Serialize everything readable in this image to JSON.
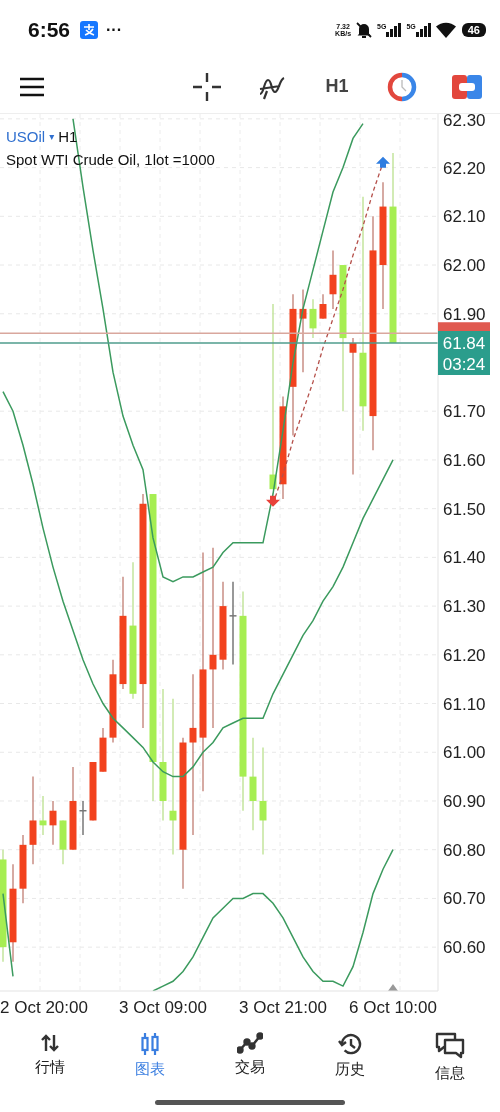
{
  "status_bar": {
    "time": "6:56",
    "more": "···",
    "speed_value": "7.32",
    "speed_unit": "KB/s",
    "network_1": "5G",
    "network_2": "5G",
    "battery": "46"
  },
  "toolbar": {
    "timeframe": "H1"
  },
  "chart": {
    "symbol": "USOil",
    "symbol_caret": "▾",
    "timeframe": "H1",
    "description": "Spot WTI Crude Oil, 1lot =1000",
    "countdown": "03:24",
    "chart_data": {
      "type": "candlestick",
      "grid": true,
      "ylim": [
        60.51,
        62.31
      ],
      "categories": [
        null,
        null,
        null,
        null,
        "2 Oct 20:00",
        null,
        null,
        null,
        null,
        null,
        null,
        null,
        null,
        null,
        null,
        null,
        "3 Oct 09:00",
        null,
        null,
        null,
        null,
        null,
        null,
        null,
        null,
        null,
        null,
        null,
        "3 Oct 21:00",
        null,
        null,
        null,
        null,
        null,
        null,
        null,
        null,
        null,
        null,
        "6 Oct 10:00"
      ],
      "yticks": [
        {
          "value": 62.3,
          "label": "62.30"
        },
        {
          "value": 62.2,
          "label": "62.20"
        },
        {
          "value": 62.1,
          "label": "62.10"
        },
        {
          "value": 62.0,
          "label": "62.00"
        },
        {
          "value": 61.9,
          "label": "61.90"
        },
        {
          "value": 61.7,
          "label": "61.70"
        },
        {
          "value": 61.6,
          "label": "61.60"
        },
        {
          "value": 61.5,
          "label": "61.50"
        },
        {
          "value": 61.4,
          "label": "61.40"
        },
        {
          "value": 61.3,
          "label": "61.30"
        },
        {
          "value": 61.2,
          "label": "61.20"
        },
        {
          "value": 61.1,
          "label": "61.10"
        },
        {
          "value": 61.0,
          "label": "61.00"
        },
        {
          "value": 60.9,
          "label": "60.90"
        },
        {
          "value": 60.8,
          "label": "60.80"
        },
        {
          "value": 60.7,
          "label": "60.70"
        },
        {
          "value": 60.6,
          "label": "60.60"
        }
      ],
      "ohlc": [
        [
          60.78,
          60.8,
          60.57,
          60.6
        ],
        [
          60.61,
          60.77,
          60.57,
          60.72
        ],
        [
          60.72,
          60.83,
          60.69,
          60.81
        ],
        [
          60.81,
          60.95,
          60.77,
          60.86
        ],
        [
          60.86,
          60.91,
          60.83,
          60.85
        ],
        [
          60.85,
          60.9,
          60.81,
          60.88
        ],
        [
          60.86,
          60.86,
          60.77,
          60.8
        ],
        [
          60.8,
          60.97,
          60.8,
          60.9
        ],
        [
          60.88,
          60.9,
          60.83,
          60.88
        ],
        [
          60.86,
          60.98,
          60.86,
          60.98
        ],
        [
          60.96,
          61.05,
          60.96,
          61.03
        ],
        [
          61.03,
          61.19,
          61.02,
          61.16
        ],
        [
          61.14,
          61.36,
          61.13,
          61.28
        ],
        [
          61.26,
          61.39,
          61.11,
          61.12
        ],
        [
          61.14,
          61.53,
          61.05,
          61.51
        ],
        [
          61.53,
          61.53,
          60.9,
          60.98
        ],
        [
          60.98,
          61.13,
          60.86,
          60.9
        ],
        [
          60.88,
          61.11,
          60.79,
          60.86
        ],
        [
          60.8,
          61.03,
          60.72,
          61.02
        ],
        [
          61.02,
          61.16,
          60.83,
          61.05
        ],
        [
          61.03,
          61.41,
          60.92,
          61.17
        ],
        [
          61.17,
          61.42,
          61.05,
          61.2
        ],
        [
          61.19,
          61.35,
          61.17,
          61.3
        ],
        [
          61.28,
          61.35,
          61.18,
          61.28
        ],
        [
          61.28,
          61.33,
          60.88,
          60.95
        ],
        [
          60.95,
          61.03,
          60.84,
          60.9
        ],
        [
          60.9,
          61.01,
          60.79,
          60.86
        ],
        [
          61.57,
          61.92,
          61.54,
          61.54
        ],
        [
          61.55,
          61.73,
          61.52,
          61.71
        ],
        [
          61.75,
          61.94,
          61.65,
          61.91
        ],
        [
          61.89,
          61.95,
          61.78,
          61.91
        ],
        [
          61.91,
          61.93,
          61.85,
          61.87
        ],
        [
          61.89,
          61.94,
          61.89,
          61.92
        ],
        [
          61.94,
          62.03,
          61.91,
          61.98
        ],
        [
          62.0,
          62.0,
          61.7,
          61.85
        ],
        [
          61.82,
          61.85,
          61.57,
          61.84
        ],
        [
          61.82,
          62.14,
          61.66,
          61.71
        ],
        [
          61.69,
          62.1,
          61.62,
          62.03
        ],
        [
          62.0,
          62.17,
          61.91,
          62.12
        ],
        [
          62.12,
          62.23,
          61.84,
          61.84
        ]
      ],
      "series": [
        {
          "type": "line",
          "color": "#3b9a5e",
          "values": [
            null,
            null,
            null,
            null,
            null,
            null,
            null,
            62.3,
            62.16,
            62.03,
            61.91,
            61.78,
            61.69,
            61.63,
            61.58,
            61.44,
            61.36,
            61.35,
            61.36,
            61.36,
            61.37,
            61.38,
            61.41,
            61.43,
            61.43,
            61.43,
            61.43,
            61.53,
            61.66,
            61.8,
            61.91,
            61.99,
            62.07,
            62.15,
            62.2,
            62.26,
            62.29,
            null,
            null,
            null
          ]
        },
        {
          "type": "line",
          "color": "#3b9a5e",
          "values": [
            61.74,
            61.7,
            61.63,
            61.55,
            61.46,
            61.38,
            61.31,
            61.25,
            61.19,
            61.14,
            61.1,
            61.07,
            61.05,
            61.03,
            61.01,
            60.98,
            60.96,
            60.95,
            60.95,
            60.97,
            61.0,
            61.02,
            61.05,
            61.06,
            61.07,
            61.07,
            61.07,
            61.12,
            61.16,
            61.2,
            61.24,
            61.27,
            61.31,
            61.34,
            61.38,
            61.43,
            61.48,
            61.52,
            61.56,
            61.6
          ]
        },
        {
          "type": "line",
          "color": "#3b9a5e",
          "values": [
            60.71,
            60.54,
            null,
            null,
            null,
            null,
            null,
            null,
            null,
            null,
            null,
            null,
            null,
            null,
            null,
            60.51,
            60.52,
            60.53,
            60.55,
            60.58,
            60.62,
            60.66,
            60.68,
            60.7,
            60.7,
            60.71,
            60.71,
            60.69,
            60.66,
            60.62,
            60.58,
            60.55,
            60.53,
            60.53,
            60.52,
            60.56,
            60.63,
            60.71,
            60.76,
            60.8
          ]
        },
        {
          "type": "line",
          "line_style": "dashed",
          "color": "#b5504a",
          "values": [
            null,
            null,
            null,
            null,
            null,
            null,
            null,
            null,
            null,
            null,
            null,
            null,
            null,
            null,
            null,
            null,
            null,
            null,
            null,
            null,
            null,
            null,
            null,
            null,
            null,
            null,
            null,
            61.51,
            61.57,
            61.64,
            61.7,
            61.76,
            61.83,
            61.89,
            61.95,
            62.02,
            62.08,
            62.15,
            62.21,
            null
          ]
        },
        {
          "type": "scatter",
          "color": "#e8423a",
          "values": [
            null,
            null,
            null,
            null,
            null,
            null,
            null,
            null,
            null,
            null,
            null,
            null,
            null,
            null,
            null,
            null,
            null,
            null,
            null,
            null,
            null,
            null,
            null,
            null,
            null,
            null,
            null,
            61.51,
            null,
            null,
            null,
            null,
            null,
            null,
            null,
            null,
            null,
            null,
            null,
            null
          ]
        },
        {
          "type": "scatter",
          "color": "#2f7de0",
          "values": [
            null,
            null,
            null,
            null,
            null,
            null,
            null,
            null,
            null,
            null,
            null,
            null,
            null,
            null,
            null,
            null,
            null,
            null,
            null,
            null,
            null,
            null,
            null,
            null,
            null,
            null,
            null,
            null,
            null,
            null,
            null,
            null,
            null,
            null,
            null,
            null,
            null,
            null,
            62.21,
            null
          ]
        }
      ],
      "ref_lines": [
        {
          "axis": "y",
          "value": 61.86,
          "color": "#d9a79d"
        },
        {
          "axis": "y",
          "value": 61.84,
          "color": "#4f9d8c",
          "label": "61.84"
        }
      ]
    }
  },
  "nav": [
    {
      "label": "行情",
      "selected": false
    },
    {
      "label": "图表",
      "selected": true
    },
    {
      "label": "交易",
      "selected": false
    },
    {
      "label": "历史",
      "selected": false
    },
    {
      "label": "信息",
      "selected": false
    }
  ]
}
